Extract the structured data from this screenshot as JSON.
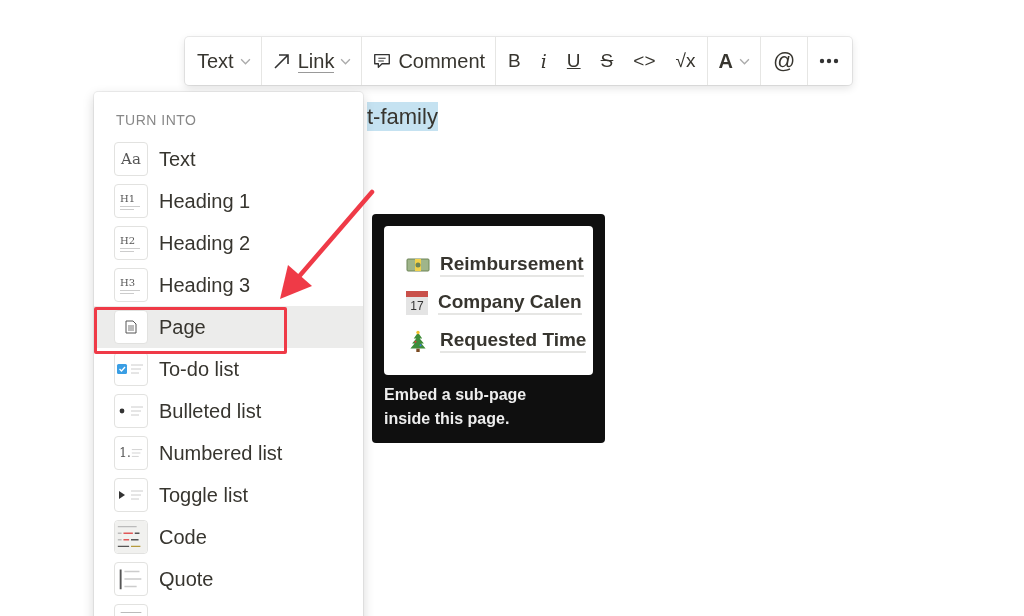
{
  "document": {
    "selected_text": "t-family"
  },
  "toolbar": {
    "items": [
      {
        "kind": "dropdown",
        "label": "Text"
      },
      {
        "kind": "link",
        "label": "Link"
      },
      {
        "kind": "comment",
        "label": "Comment"
      },
      {
        "kind": "format",
        "label": "B"
      },
      {
        "kind": "format",
        "label": "i"
      },
      {
        "kind": "format",
        "label": "U"
      },
      {
        "kind": "format",
        "label": "S"
      },
      {
        "kind": "format",
        "label": "<>"
      },
      {
        "kind": "format",
        "label": "√x"
      },
      {
        "kind": "dropdown",
        "label": "A"
      },
      {
        "kind": "format",
        "label": "@"
      },
      {
        "kind": "more"
      }
    ]
  },
  "menu": {
    "heading": "TURN INTO",
    "items": [
      {
        "kind": "text",
        "icon_label": "Aa",
        "label": "Text",
        "selected": false
      },
      {
        "kind": "heading",
        "icon_label": "H1",
        "label": "Heading 1",
        "selected": false
      },
      {
        "kind": "heading",
        "icon_label": "H2",
        "label": "Heading 2",
        "selected": false
      },
      {
        "kind": "heading",
        "icon_label": "H3",
        "label": "Heading 3",
        "selected": false
      },
      {
        "kind": "page",
        "label": "Page",
        "selected": true
      },
      {
        "kind": "todo",
        "label": "To-do list",
        "selected": false
      },
      {
        "kind": "bullet",
        "label": "Bulleted list",
        "selected": false
      },
      {
        "kind": "numbered",
        "icon_label": "1.",
        "label": "Numbered list",
        "selected": false
      },
      {
        "kind": "toggle",
        "label": "Toggle list",
        "selected": false
      },
      {
        "kind": "code",
        "label": "Code",
        "selected": false
      },
      {
        "kind": "quote",
        "label": "Quote",
        "selected": false
      },
      {
        "kind": "callout",
        "selected": false
      }
    ]
  },
  "tooltip": {
    "pages": [
      {
        "kind": "money",
        "title": "Reimbursement"
      },
      {
        "kind": "calendar",
        "title": "Company Calen",
        "date": "17"
      },
      {
        "kind": "tree",
        "title": "Requested Time"
      }
    ],
    "description": "Embed a sub-page inside this page."
  }
}
